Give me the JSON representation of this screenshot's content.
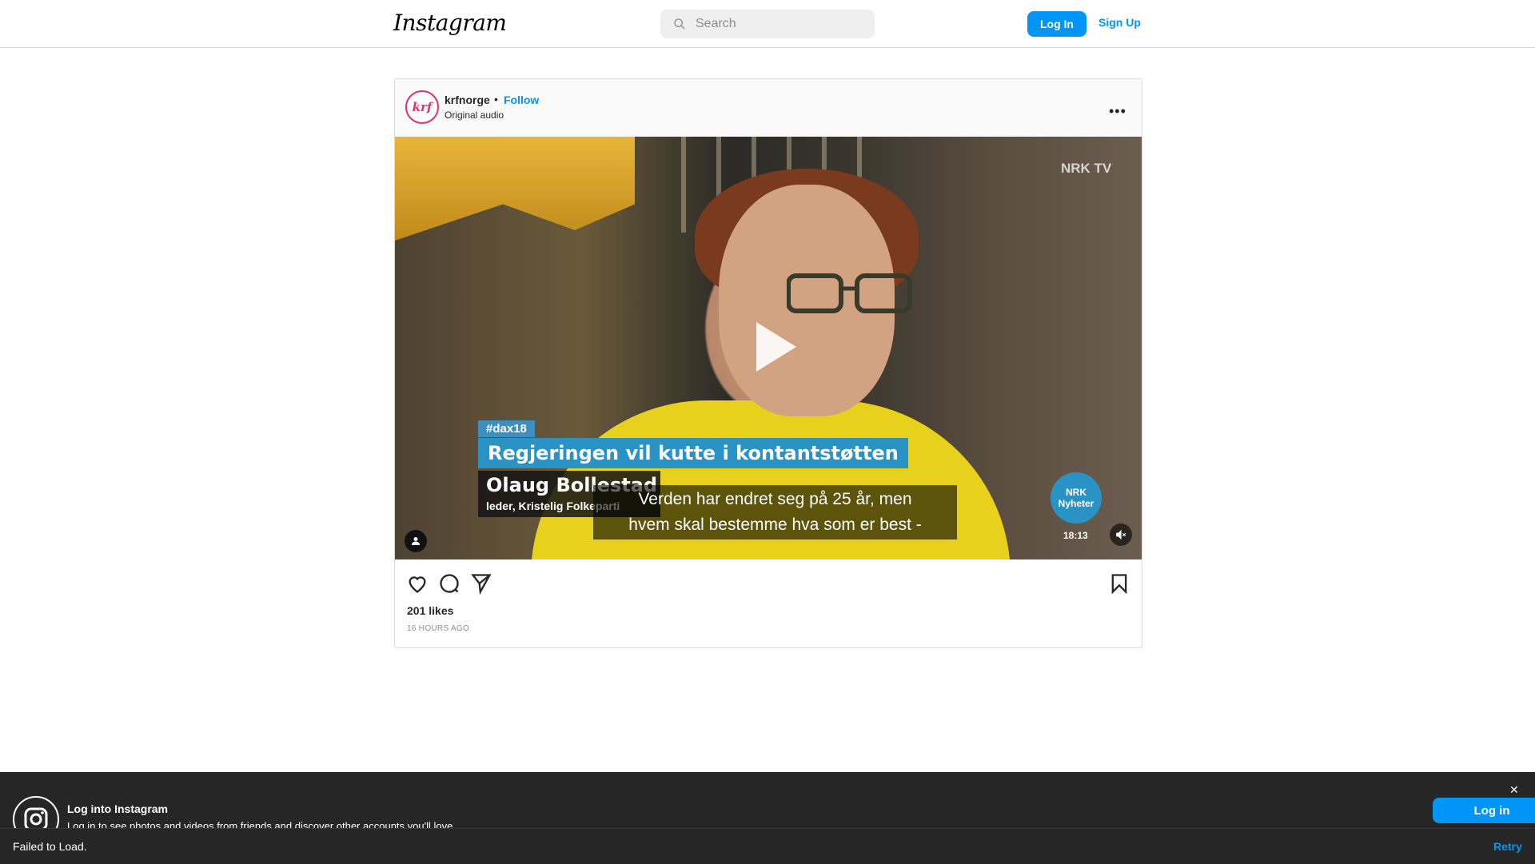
{
  "header": {
    "logo_text": "Instagram",
    "search_placeholder": "Search",
    "login_label": "Log In",
    "signup_label": "Sign Up"
  },
  "post": {
    "avatar_text": "krf",
    "username": "krfnorge",
    "separator": "•",
    "follow_label": "Follow",
    "audio": "Original audio",
    "more_label": "•••",
    "likes": "201 likes",
    "time_ago": "16 HOURS AGO"
  },
  "video": {
    "hashtag": "#dax18",
    "headline": "Regjeringen vil kutte i kontantstøtten",
    "person_name": "Olaug Bollestad",
    "person_role": "leder, Kristelig Folkeparti",
    "subtitle_line1": "Verden har endret seg på 25 år, men",
    "subtitle_line2": "hvem skal bestemme hva som er best -",
    "broadcaster": "NRK TV",
    "badge_line1": "NRK",
    "badge_line2": "Nyheter",
    "timestamp": "18:13"
  },
  "login_banner": {
    "title": "Log into Instagram",
    "subtitle": "Log in to see photos and videos from friends and discover other accounts you'll love.",
    "login_label": "Log in",
    "close_label": "✕"
  },
  "error_bar": {
    "message": "Failed to Load.",
    "retry_label": "Retry"
  },
  "colors": {
    "accent": "#0095f6",
    "banner_bg": "#262626"
  }
}
